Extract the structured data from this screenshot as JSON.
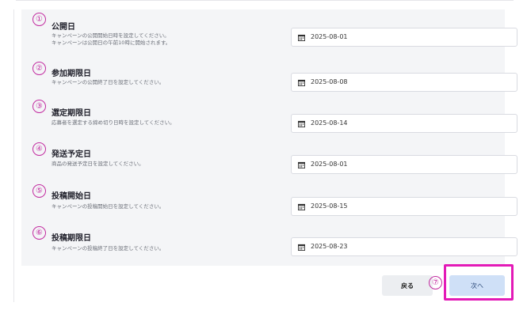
{
  "fields": [
    {
      "marker": "①",
      "title": "公開日",
      "desc_lines": [
        "キャンペーンの公開開始日時を設定してください。",
        "キャンペーンは公開日の午前10時に開始されます。"
      ],
      "value": "2025-08-01"
    },
    {
      "marker": "②",
      "title": "参加期限日",
      "desc_lines": [
        "キャンペーンの公開終了日を設定してください。"
      ],
      "value": "2025-08-08"
    },
    {
      "marker": "③",
      "title": "選定期限日",
      "desc_lines": [
        "応募者を選定する締め切り日時を設定してください。"
      ],
      "value": "2025-08-14"
    },
    {
      "marker": "④",
      "title": "発送予定日",
      "desc_lines": [
        "商品の発送予定日を設定してください。"
      ],
      "value": "2025-08-01"
    },
    {
      "marker": "⑤",
      "title": "投稿開始日",
      "desc_lines": [
        "キャンペーンの投稿開始日を設定してください。"
      ],
      "value": "2025-08-15"
    },
    {
      "marker": "⑥",
      "title": "投稿期限日",
      "desc_lines": [
        "キャンペーンの投稿終了日を設定してください。"
      ],
      "value": "2025-08-23"
    }
  ],
  "footer": {
    "back_label": "戻る",
    "next_marker": "⑦",
    "next_label": "次へ"
  },
  "icons": {
    "calendar": "calendar-icon"
  },
  "colors": {
    "annotation": "#e31ab7",
    "next_button_bg": "#cfe0f7",
    "panel_bg": "#f4f5f7"
  }
}
